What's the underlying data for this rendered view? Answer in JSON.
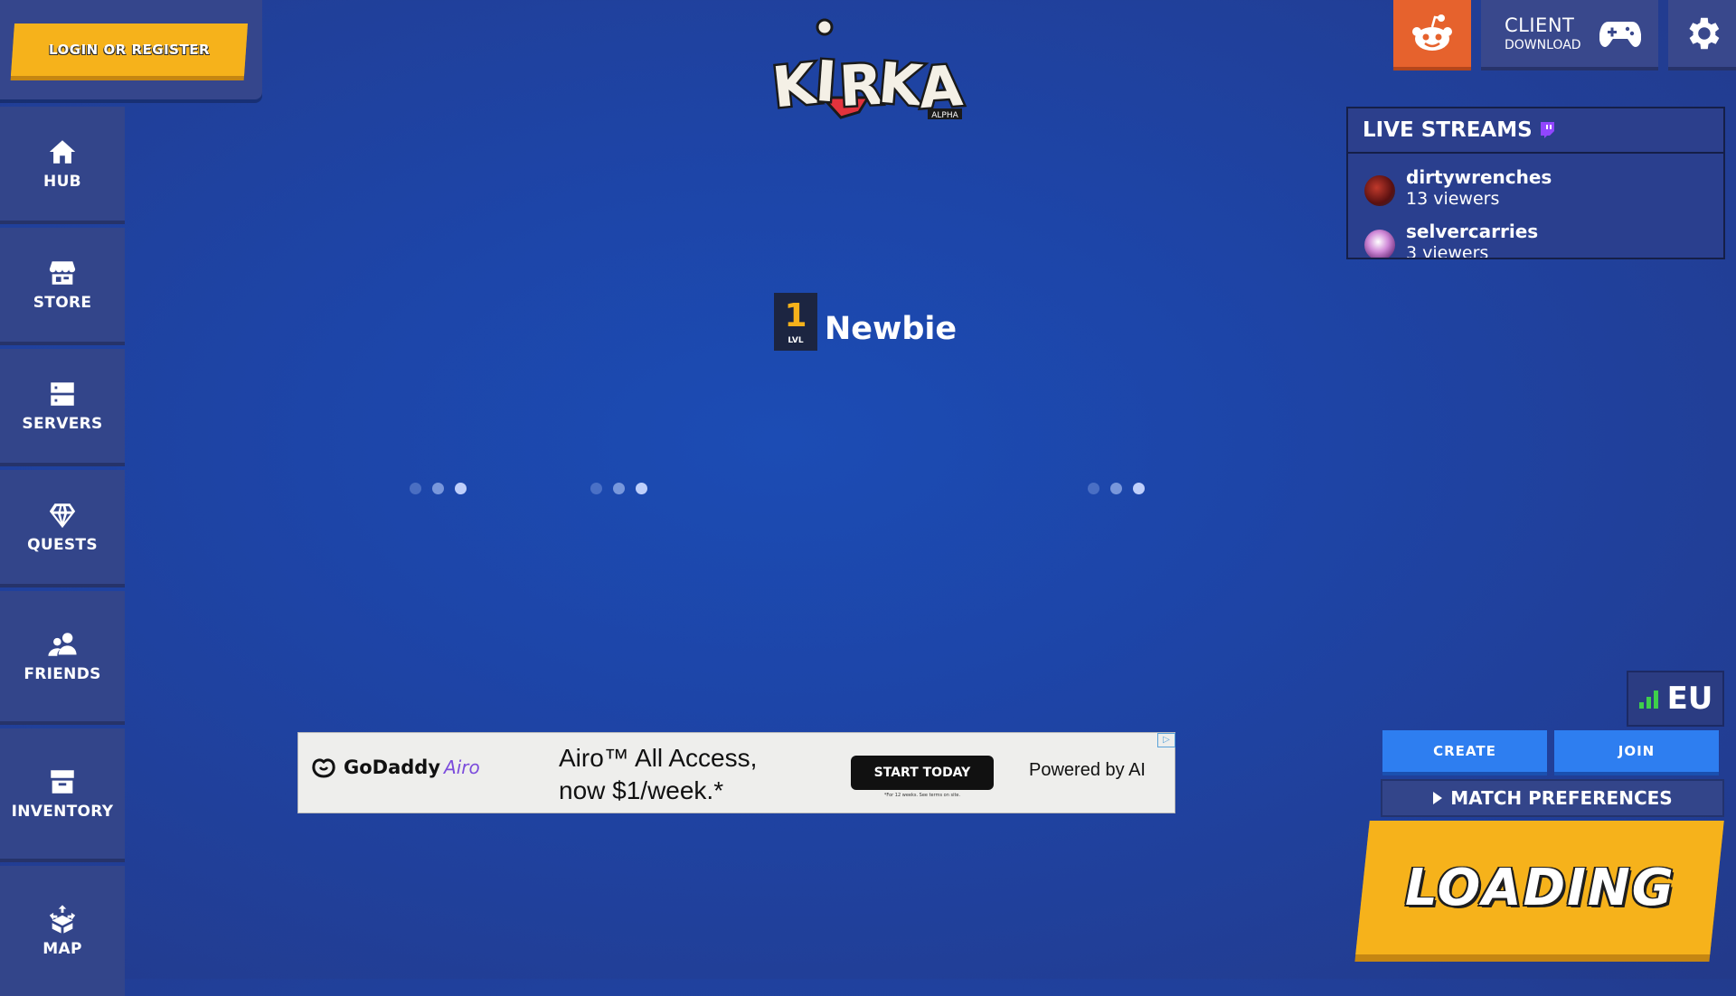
{
  "auth": {
    "login_label": "LOGIN OR REGISTER"
  },
  "sidebar": {
    "items": [
      {
        "label": "HUB",
        "icon": "home-icon"
      },
      {
        "label": "STORE",
        "icon": "store-icon"
      },
      {
        "label": "SERVERS",
        "icon": "servers-icon"
      },
      {
        "label": "QUESTS",
        "icon": "diamond-icon"
      },
      {
        "label": "FRIENDS",
        "icon": "friends-icon"
      },
      {
        "label": "INVENTORY",
        "icon": "inventory-icon"
      },
      {
        "label": "MAP",
        "icon": "map-icon"
      }
    ]
  },
  "logo": {
    "text": "KIRKA",
    "tag": "ALPHA"
  },
  "topbar": {
    "reddit_icon": "reddit-icon",
    "client_title": "CLIENT",
    "client_sub": "DOWNLOAD",
    "client_icon": "gamepad-icon",
    "settings_icon": "gear-icon"
  },
  "streams": {
    "title": "LIVE STREAMS",
    "items": [
      {
        "name": "dirtywrenches",
        "viewers": "13 viewers"
      },
      {
        "name": "selvercarries",
        "viewers": "3 viewers"
      }
    ]
  },
  "player": {
    "level": "1",
    "level_label": "LVL",
    "name": "Newbie"
  },
  "ad": {
    "brand": "GoDaddy",
    "brand_product": "Airo",
    "headline_1": "Airo™ All Access,",
    "headline_2": "now $1/week.*",
    "cta": "START TODAY",
    "fine_print": "*For 12 weeks. See terms on site.",
    "powered": "Powered by AI",
    "badge": "▷"
  },
  "match": {
    "region": "EU",
    "create_label": "CREATE",
    "join_label": "JOIN",
    "preferences_label": "MATCH PREFERENCES",
    "play_label": "LOADING"
  },
  "colors": {
    "accent_yellow": "#f6b21b",
    "reddit_orange": "#e6622d",
    "button_blue": "#2e7ef0",
    "panel_blue": "#33458a"
  }
}
